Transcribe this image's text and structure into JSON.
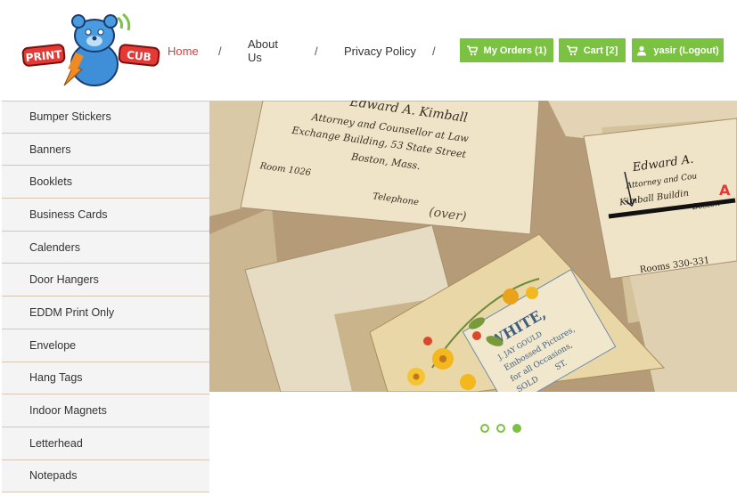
{
  "brand": {
    "logo_text_left": "PRINT",
    "logo_text_right": "CUB"
  },
  "nav": {
    "items": [
      "Home",
      "About Us",
      "Privacy Policy"
    ],
    "separator": "/",
    "active_color": "#e53935"
  },
  "header_buttons": {
    "orders": "My Orders (1)",
    "cart": "Cart [2]",
    "user": "yasir (Logout)",
    "color": "#7cc242"
  },
  "sidebar": {
    "items": [
      "Bumper Stickers",
      "Banners",
      "Booklets",
      "Business Cards",
      "Calenders",
      "Door Hangers",
      "EDDM Print Only",
      "Envelope",
      "Hang Tags",
      "Indoor Magnets",
      "Letterhead",
      "Notepads"
    ]
  },
  "slider": {
    "card1_lines": [
      "Edward A. Kimball",
      "Attorney and Counsellor at Law",
      "Exchange Building, 53 State Street",
      "Boston, Mass.",
      "Room 1026",
      "Telephone",
      "(over)"
    ],
    "card2_lines": [
      "Edward A.",
      "Attorney and Cou",
      "Kimball Buildin",
      "Boston",
      "Rooms 330-331",
      "A"
    ],
    "card3_lines": [
      "WHITE,",
      "J. JAY GOULD",
      "Embossed Pictures,",
      "for all Occasions,",
      "SOLD",
      "ST."
    ],
    "dots_total": 3,
    "dots_active": 3
  }
}
